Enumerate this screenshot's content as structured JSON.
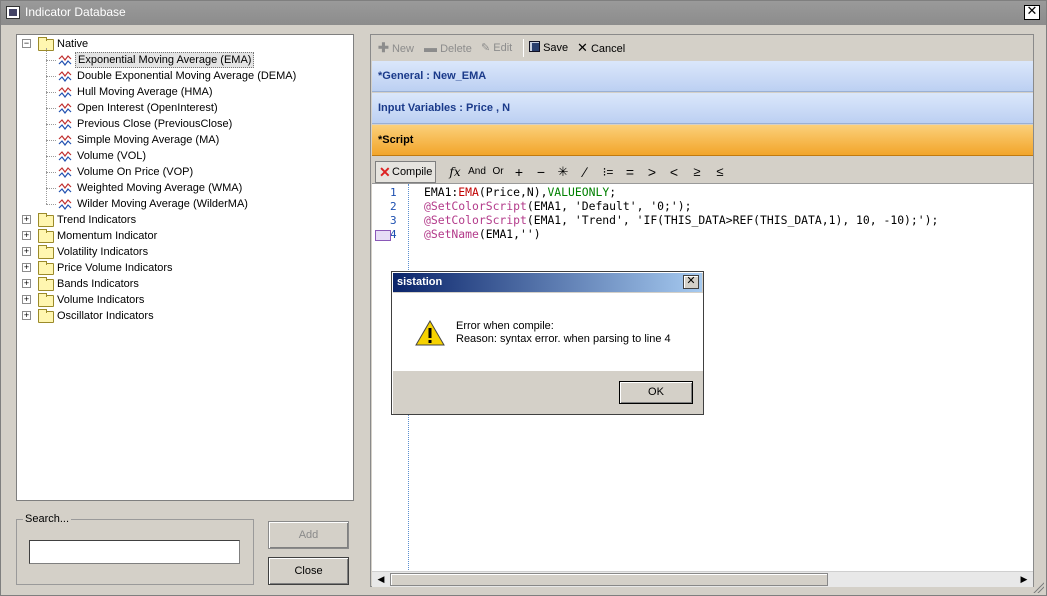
{
  "window": {
    "title": "Indicator Database"
  },
  "tree": {
    "groups": [
      {
        "label": "Native",
        "expanded": true,
        "items": [
          "Exponential Moving Average (EMA)",
          "Double Exponential Moving Average (DEMA)",
          "Hull Moving Average (HMA)",
          "Open Interest (OpenInterest)",
          "Previous Close (PreviousClose)",
          "Simple Moving Average (MA)",
          "Volume (VOL)",
          "Volume On Price (VOP)",
          "Weighted Moving Average (WMA)",
          "Wilder Moving Average (WilderMA)"
        ]
      },
      {
        "label": "Trend Indicators"
      },
      {
        "label": "Momentum Indicator"
      },
      {
        "label": "Volatility Indicators"
      },
      {
        "label": "Price Volume Indicators"
      },
      {
        "label": "Bands Indicators"
      },
      {
        "label": "Volume Indicators"
      },
      {
        "label": "Oscillator Indicators"
      }
    ],
    "selected": "Exponential Moving Average (EMA)"
  },
  "search": {
    "label": "Search...",
    "value": ""
  },
  "buttons": {
    "add": "Add",
    "close": "Close"
  },
  "toolbar": {
    "new": "New",
    "delete": "Delete",
    "edit": "Edit",
    "save": "Save",
    "cancel": "Cancel"
  },
  "sections": {
    "general": "*General : New_EMA",
    "inputs": "Input Variables : Price , N",
    "script": "*Script"
  },
  "code_toolbar": {
    "compile": "Compile",
    "and": "And",
    "or": "Or"
  },
  "code": {
    "line_numbers": [
      "1",
      "2",
      "3",
      "4"
    ],
    "lines": [
      "EMA1:EMA(Price,N),VALUEONLY;",
      "@SetColorScript(EMA1, 'Default', '0;');",
      "@SetColorScript(EMA1, 'Trend', 'IF(THIS_DATA>REF(THIS_DATA,1), 10, -10);');",
      "@SetName(EMA1,'')"
    ]
  },
  "dialog": {
    "title": "sistation",
    "line1": "Error when compile:",
    "line2": "Reason: syntax error. when parsing to line 4",
    "ok": "OK"
  },
  "colors": {
    "section_blue": "#c8d8f4",
    "section_orange": "#f5b040",
    "dialog_title": "#0a246a"
  }
}
